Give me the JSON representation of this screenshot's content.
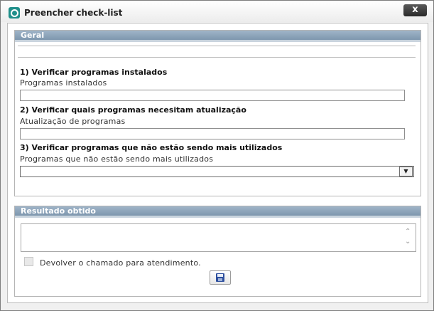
{
  "window": {
    "title": "Preencher check-list",
    "close_label": "x"
  },
  "geral": {
    "header": "Geral",
    "q1_title": "1) Verificar programas instalados",
    "q1_label": "Programas instalados",
    "q1_value": "",
    "q2_title": "2) Verificar quais programas necesitam atualização",
    "q2_label": "Atualização de programas",
    "q2_value": "",
    "q3_title": "3) Verificar programas que não estão sendo mais utilizados",
    "q3_label": "Programas que não estão sendo mais utilizados",
    "q3_selected": ""
  },
  "resultado": {
    "header": "Resultado obtido",
    "text": "",
    "checkbox_label": "Devolver o chamado para atendimento.",
    "checkbox_checked": false
  },
  "icons": {
    "app": "app-logo-icon",
    "close": "close-icon",
    "dropdown": "chevron-down-icon",
    "scroll_up": "chevron-up-icon",
    "scroll_down": "chevron-down-icon",
    "save": "floppy-disk-icon"
  },
  "colors": {
    "panel_header": "#8aa0b6",
    "app_icon": "#1f8f8a",
    "save_icon": "#2d4f9e"
  }
}
